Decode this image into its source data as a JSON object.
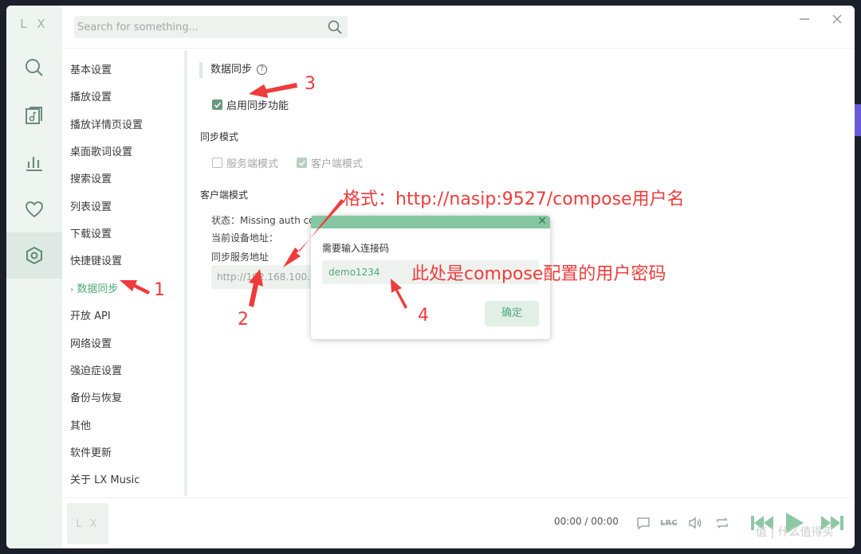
{
  "app": {
    "logo": "L X"
  },
  "search": {
    "placeholder": "Search for something..."
  },
  "menu": {
    "items": [
      "基本设置",
      "播放设置",
      "播放详情页设置",
      "桌面歌词设置",
      "搜索设置",
      "列表设置",
      "下载设置",
      "快捷键设置",
      "数据同步",
      "开放 API",
      "网络设置",
      "强迫症设置",
      "备份与恢复",
      "其他",
      "软件更新",
      "关于 LX Music"
    ],
    "active_index": 8,
    "active_chevron": "›"
  },
  "content": {
    "section_title": "数据同步",
    "help": "?",
    "enable_sync": {
      "label": "启用同步功能",
      "checked": true
    },
    "mode_title": "同步模式",
    "server_mode": {
      "label": "服务端模式",
      "checked": false
    },
    "client_mode": {
      "label": "客户端模式",
      "checked": true
    },
    "client_title": "客户端模式",
    "status": "状态：Missing auth code",
    "device_addr_label": "当前设备地址：",
    "server_addr_label": "同步服务地址",
    "server_addr_value": "http://192.168.100.",
    "server_addr_placeholder": ""
  },
  "dialog": {
    "close": "✕",
    "label": "需要输入连接码",
    "input_value": "demo1234",
    "confirm": "确定"
  },
  "player": {
    "cover": "L X",
    "time_current": "00:00",
    "time_sep": " / ",
    "time_total": "00:00",
    "lrc": "LRC"
  },
  "annotations": {
    "a1": "1",
    "a2": "2",
    "a3": "3",
    "a4": "4",
    "format_note": "格式：http://nasip:9527/compose用户名",
    "password_note": "此处是compose配置的用户密码"
  },
  "watermark": "值 | 什么值得买",
  "colors": {
    "accent": "#4fa87a",
    "annotation": "#ef3b3b",
    "sidebar": "#eef5f1"
  }
}
